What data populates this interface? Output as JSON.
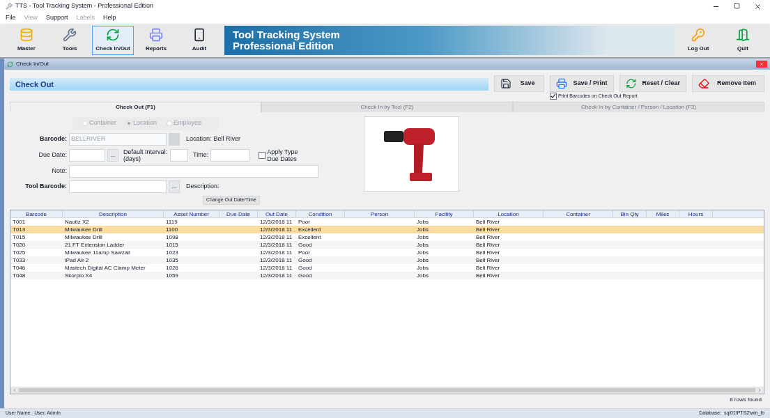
{
  "window": {
    "title": "TTS - Tool Tracking System - Professional Edition"
  },
  "menu": [
    {
      "label": "File",
      "disabled": false
    },
    {
      "label": "View",
      "disabled": true
    },
    {
      "label": "Support",
      "disabled": false
    },
    {
      "label": "Labels",
      "disabled": true
    },
    {
      "label": "Help",
      "disabled": false
    }
  ],
  "toolbar": {
    "left": [
      {
        "label": "Master",
        "selected": false
      },
      {
        "label": "Tools",
        "selected": false
      },
      {
        "label": "Check In/Out",
        "selected": true
      },
      {
        "label": "Reports",
        "selected": false
      },
      {
        "label": "Audit",
        "selected": false
      }
    ],
    "banner": [
      "Tool Tracking System",
      "Professional Edition"
    ],
    "right": [
      {
        "label": "Log Out"
      },
      {
        "label": "Quit"
      }
    ]
  },
  "subwindow": {
    "title": "Check In/Out"
  },
  "header": {
    "title": "Check Out",
    "actions": [
      "Save",
      "Save / Print",
      "Reset / Clear",
      "Remove Item"
    ],
    "print_option": {
      "label": "Print Barcodes on Check Out Report",
      "checked": true
    }
  },
  "tabs": [
    {
      "label": "Check Out (F1)",
      "selected": true
    },
    {
      "label": "Check In by Tool (F2)",
      "selected": false
    },
    {
      "label": "Check In by Container / Person / Location (F3)",
      "selected": false
    }
  ],
  "form": {
    "radios": [
      {
        "label": "Container",
        "selected": false,
        "disabled": true
      },
      {
        "label": "Location",
        "selected": true,
        "disabled": true
      },
      {
        "label": "Employee",
        "selected": false,
        "disabled": true
      }
    ],
    "barcode": {
      "label": "Barcode:",
      "value": "BELLRIVER",
      "disabled": true
    },
    "location": {
      "label": "Location:",
      "value": "Bell River"
    },
    "due_date": {
      "label": "Due Date:",
      "button": "..."
    },
    "interval": {
      "label": "Default Interval: (days)"
    },
    "time": {
      "label": "Time:"
    },
    "apply_type": {
      "label": "Apply Type Due Dates",
      "checked": false
    },
    "note": {
      "label": "Note:"
    },
    "tool_barcode": {
      "label": "Tool Barcode:",
      "button": "..."
    },
    "description": {
      "label": "Description:"
    },
    "change_button": "Change Out Date/Time"
  },
  "table": {
    "columns": [
      "Barcode",
      "Description",
      "Asset Number",
      "Due Date",
      "Out Date",
      "Condition",
      "Person",
      "Facility",
      "Location",
      "Container",
      "Bin Qty",
      "Miles",
      "Hours"
    ],
    "rows": [
      {
        "selected": false,
        "cells": [
          "T001",
          "Nautiz X2",
          "1119",
          "",
          "12/3/2018 11",
          "Poor",
          "",
          "Jobs",
          "Bell River",
          "",
          "",
          "",
          ""
        ]
      },
      {
        "selected": true,
        "cells": [
          "T013",
          "Milwaukee Drill",
          "1100",
          "",
          "12/3/2018 11",
          "Excellent",
          "",
          "Jobs",
          "Bell River",
          "",
          "",
          "",
          ""
        ]
      },
      {
        "selected": false,
        "cells": [
          "T015",
          "Milwaukee Drill",
          "1098",
          "",
          "12/3/2018 11",
          "Excellent",
          "",
          "Jobs",
          "Bell River",
          "",
          "",
          "",
          ""
        ]
      },
      {
        "selected": false,
        "cells": [
          "T020",
          "21 FT Extension Ladder",
          "1015",
          "",
          "12/3/2018 11",
          "Good",
          "",
          "Jobs",
          "Bell River",
          "",
          "",
          "",
          ""
        ]
      },
      {
        "selected": false,
        "cells": [
          "T025",
          "Milwaukee 11amp Sawzall",
          "1023",
          "",
          "12/3/2018 11",
          "Poor",
          "",
          "Jobs",
          "Bell River",
          "",
          "",
          "",
          ""
        ]
      },
      {
        "selected": false,
        "cells": [
          "T033",
          "iPad Air 2",
          "1035",
          "",
          "12/3/2018 11",
          "Good",
          "",
          "Jobs",
          "Bell River",
          "",
          "",
          "",
          ""
        ]
      },
      {
        "selected": false,
        "cells": [
          "T046",
          "Mastech Digital AC Clamp Meter",
          "1026",
          "",
          "12/3/2018 11",
          "Good",
          "",
          "Jobs",
          "Bell River",
          "",
          "",
          "",
          ""
        ]
      },
      {
        "selected": false,
        "cells": [
          "T048",
          "Skorpio X4",
          "1059",
          "",
          "12/3/2018 11",
          "Good",
          "",
          "Jobs",
          "Bell River",
          "",
          "",
          "",
          ""
        ]
      }
    ],
    "rows_found": "8 rows found"
  },
  "status_bar": {
    "user": "User Name:  User, Admin",
    "database": "Database:  sql01\\PTS2\\win_lb"
  }
}
